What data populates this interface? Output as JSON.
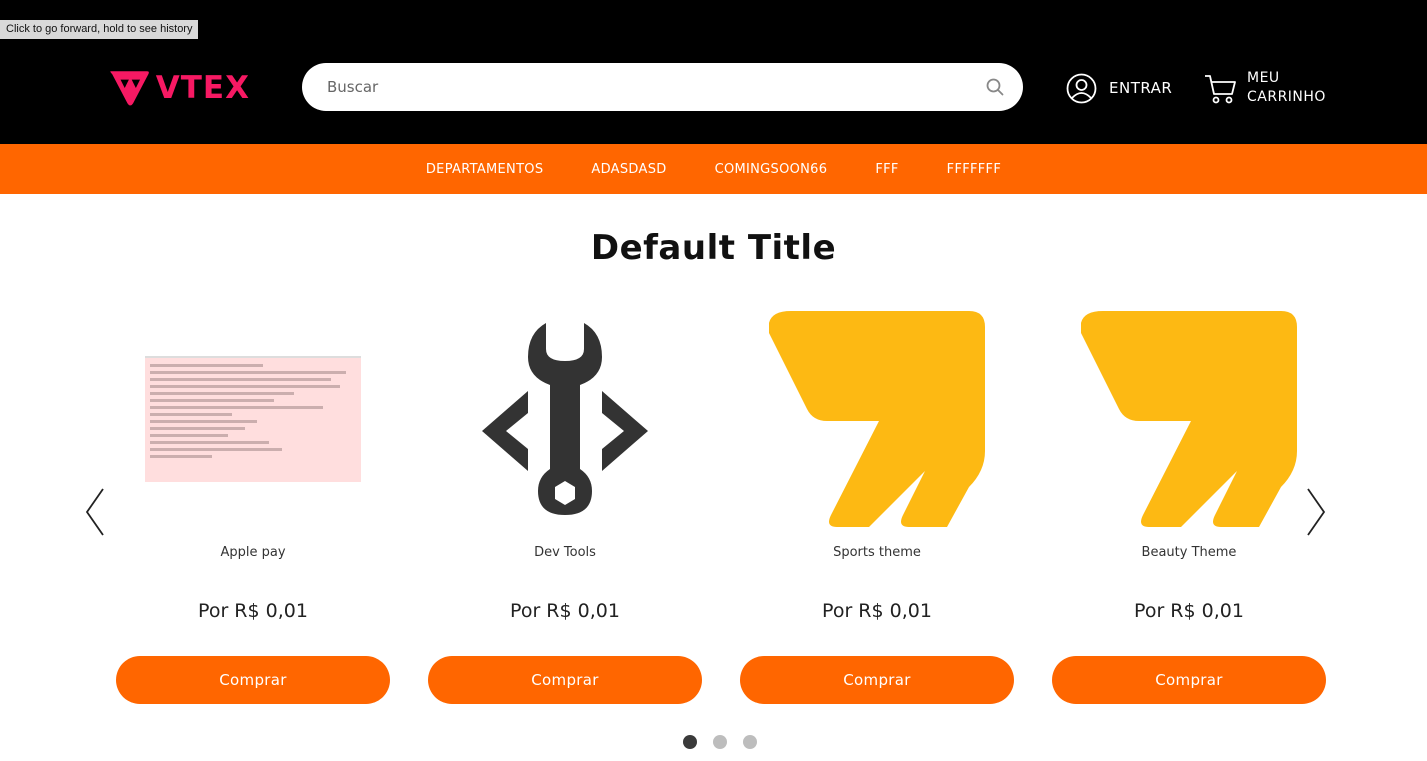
{
  "browser": {
    "tooltip": "Click to go forward, hold to see history"
  },
  "header": {
    "logo_text": "VTEX",
    "search_placeholder": "Buscar",
    "login_label": "ENTRAR",
    "cart_label_line1": "MEU",
    "cart_label_line2": "CARRINHO"
  },
  "nav": {
    "items": [
      "DEPARTAMENTOS",
      "ADASDASD",
      "COMINGSOON66",
      "FFF",
      "FFFFFFF"
    ]
  },
  "shelf": {
    "title": "Default Title",
    "products": [
      {
        "name": "Apple pay",
        "price": "Por R$ 0,01",
        "button": "Comprar",
        "image": "screenshot-thumbnail"
      },
      {
        "name": "Dev Tools",
        "price": "Por R$ 0,01",
        "button": "Comprar",
        "image": "wrench-code-icon"
      },
      {
        "name": "Sports theme",
        "price": "Por R$ 0,01",
        "button": "Comprar",
        "image": "yellow-lightning-logo"
      },
      {
        "name": "Beauty Theme",
        "price": "Por R$ 0,01",
        "button": "Comprar",
        "image": "yellow-lightning-logo"
      }
    ],
    "pagination": {
      "pages": 3,
      "active": 1
    }
  },
  "colors": {
    "brand_pink": "#f71963",
    "accent_orange": "#ff6600",
    "header_bg": "#000000",
    "logo_yellow": "#fdb913"
  }
}
